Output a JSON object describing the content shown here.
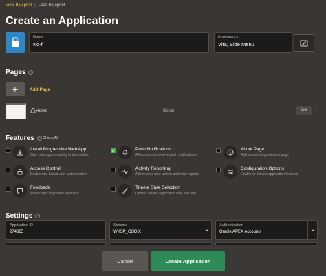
{
  "breadcrumb": {
    "view_blueprint": "View Blueprint",
    "separator": "|",
    "load_blueprint": "Load Blueprint"
  },
  "page_title": "Create an Application",
  "name_field": {
    "label": "Name",
    "value": "Ko-fi"
  },
  "appearance_field": {
    "label": "Appearance",
    "value": "Vita, Side Menu"
  },
  "pages": {
    "heading": "Pages",
    "add_page_label": "Add Page",
    "items": [
      {
        "name": "Home",
        "type": "Blank",
        "edit_label": "Edit"
      }
    ]
  },
  "features": {
    "heading": "Features",
    "check_all_label": "Check All",
    "items": [
      {
        "title": "Install Progressive Web App",
        "desc": "Give your app the ability to be installed",
        "checked": false,
        "icon": "install-icon"
      },
      {
        "title": "Push Notifications",
        "desc": "Allow users to receive push notifications",
        "checked": true,
        "icon": "bell-icon"
      },
      {
        "title": "About Page",
        "desc": "Add about this application page",
        "checked": false,
        "icon": "info-icon"
      },
      {
        "title": "Access Control",
        "desc": "Enable role-based user authorization",
        "checked": false,
        "icon": "lock-icon"
      },
      {
        "title": "Activity Reporting",
        "desc": "Allow users user activity and error reports",
        "checked": false,
        "icon": "activity-icon"
      },
      {
        "title": "Configuration Options",
        "desc": "Enable or disable application features",
        "checked": false,
        "icon": "sliders-icon"
      },
      {
        "title": "Feedback",
        "desc": "Allow users to provide feedback",
        "checked": false,
        "icon": "comment-icon"
      },
      {
        "title": "Theme Style Selection",
        "desc": "Update default application look and feel",
        "checked": false,
        "icon": "brush-icon"
      }
    ]
  },
  "settings": {
    "heading": "Settings",
    "application_id": {
      "label": "Application ID",
      "value": "274365"
    },
    "schema": {
      "label": "Schema",
      "value": "WKSP_CODIX"
    },
    "authentication": {
      "label": "Authentication",
      "value": "Oracle APEX Accounts"
    }
  },
  "footer": {
    "cancel_label": "Cancel",
    "create_label": "Create Application"
  },
  "colors": {
    "background": "#393633",
    "accent_link": "#f0c040",
    "primary_button": "#2e8a57",
    "app_icon": "#2e86c9"
  }
}
